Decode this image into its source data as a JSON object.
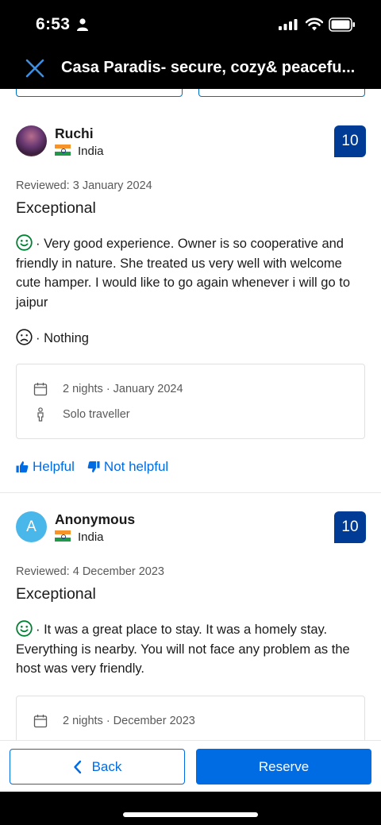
{
  "status_bar": {
    "time": "6:53"
  },
  "header": {
    "title": "Casa Paradis- secure, cozy& peacefu..."
  },
  "reviews": [
    {
      "name": "Ruchi",
      "country": "India",
      "score": "10",
      "date": "Reviewed: 3 January 2024",
      "title": "Exceptional",
      "positive": "· Very good experience. Owner is so cooperative and friendly in nature. She treated us very well with welcome cute hamper. I would like to go again whenever i will go to jaipur",
      "negative": "· Nothing",
      "stay": "2 nights · January 2024",
      "traveller": "Solo traveller"
    },
    {
      "name": "Anonymous",
      "avatar_letter": "A",
      "country": "India",
      "score": "10",
      "date": "Reviewed: 4 December 2023",
      "title": "Exceptional",
      "positive": "· It was a great place to stay. It was a homely stay. Everything is nearby. You will not face any problem as the host was very friendly.",
      "stay": "2 nights · December 2023"
    }
  ],
  "feedback": {
    "helpful": "Helpful",
    "not_helpful": "Not helpful"
  },
  "bottom_bar": {
    "back": "Back",
    "reserve": "Reserve"
  },
  "colors": {
    "brand_blue": "#006ce4",
    "score_navy": "#003b95",
    "positive_green": "#008234"
  },
  "icons": [
    "person-icon",
    "signal-icon",
    "wifi-icon",
    "battery-icon",
    "close-icon",
    "smile-icon",
    "frown-icon",
    "calendar-icon",
    "traveller-icon",
    "thumbs-up-icon",
    "thumbs-down-icon",
    "chevron-left-icon"
  ]
}
